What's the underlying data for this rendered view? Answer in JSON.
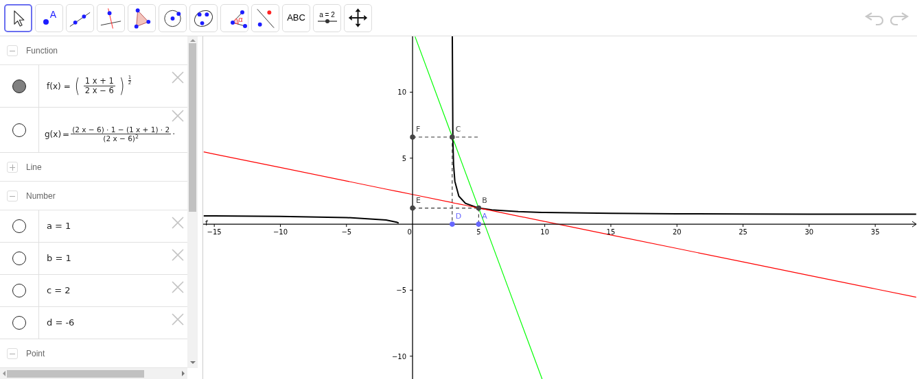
{
  "toolbar": {
    "tools": [
      {
        "kind": "move",
        "selected": true
      },
      {
        "kind": "point",
        "label": "A",
        "selected": false
      },
      {
        "kind": "line",
        "selected": false
      },
      {
        "kind": "perpendicular",
        "selected": false
      },
      {
        "kind": "polygon",
        "selected": false
      },
      {
        "kind": "circle",
        "selected": false
      },
      {
        "kind": "conic",
        "selected": false
      },
      {
        "kind": "angle",
        "label": "α",
        "selected": false
      },
      {
        "kind": "reflect",
        "selected": false
      },
      {
        "kind": "text",
        "label": "ABC",
        "selected": false
      },
      {
        "kind": "slider",
        "label": "a = 2",
        "selected": false
      },
      {
        "kind": "move_view",
        "selected": false
      }
    ],
    "undo_disabled": true,
    "redo_disabled": true
  },
  "algebra": {
    "groups": [
      {
        "title": "Function",
        "expanded": true,
        "items": [
          {
            "kind": "power",
            "visible": true,
            "name": "f(x)",
            "equals": "=",
            "left": "(",
            "numerator": "1 x + 1",
            "denominator": "2 x − 6",
            "right": ")",
            "exponent_numerator": "1",
            "exponent_denominator": "2"
          },
          {
            "kind": "fraction",
            "visible": false,
            "name": "g(x)",
            "equals": "=",
            "numerator": "(2 x − 6) · 1 − (1 x + 1) · 2",
            "denominator": "(2 x − 6)$^{2}$",
            "trailing": "·"
          }
        ]
      },
      {
        "title": "Line",
        "expanded": false
      },
      {
        "title": "Number",
        "expanded": true,
        "items": [
          {
            "kind": "text",
            "visible": false,
            "text": "a = 1"
          },
          {
            "kind": "text",
            "visible": false,
            "text": "b = 1"
          },
          {
            "kind": "text",
            "visible": false,
            "text": "c = 2"
          },
          {
            "kind": "text",
            "visible": false,
            "text": "d = -6"
          }
        ]
      },
      {
        "title": "Point",
        "expanded": true
      }
    ]
  },
  "graphics": {
    "chart_data": {
      "type": "line",
      "x": [
        -15.8,
        -15,
        -10,
        -5,
        -2,
        -1.2,
        -1.05,
        0.19,
        3.0099,
        3.05,
        3.1,
        3.2,
        3.5,
        4,
        5,
        6,
        8,
        9.8,
        10,
        15,
        20,
        25,
        30,
        35,
        38.1
      ],
      "series": [
        {
          "name": "f",
          "color": "#000000",
          "values": [
            0.63,
            0.62,
            0.59,
            0.5,
            0.32,
            0.15,
            0.08,
            null,
            14.23,
            6.36,
            4.53,
            3.24,
            2.12,
            1.58,
            1.22,
            1.08,
            0.95,
            0.89,
            0.89,
            0.82,
            0.79,
            0.77,
            0.76,
            0.75,
            0.75
          ]
        },
        {
          "color": "#ff0000",
          "values": [
            5.47,
            5.31,
            4.29,
            3.27,
            2.65,
            2.49,
            2.46,
            2.21,
            1.63,
            1.62,
            1.61,
            1.59,
            1.53,
            1.43,
            1.22,
            1.02,
            0.61,
            0.25,
            0.2,
            -0.82,
            -1.84,
            -2.86,
            -3.88,
            -4.9,
            -5.53
          ]
        },
        {
          "color": "#00ff00",
          "values": [
            null,
            null,
            null,
            null,
            null,
            null,
            null,
            14.21,
            6.6,
            6.49,
            6.35,
            6.09,
            5.27,
            3.92,
            1.22,
            -1.48,
            -6.88,
            -11.73,
            null,
            null,
            null,
            null,
            null,
            null,
            null
          ]
        }
      ],
      "xlim": [
        -15.84,
        38.16
      ],
      "ylim": [
        -11.73,
        14.23
      ],
      "xticks": [
        {
          "value": -15,
          "label": "−15"
        },
        {
          "value": -10,
          "label": "−10"
        },
        {
          "value": -5,
          "label": "−5"
        },
        0,
        5,
        10,
        15,
        20,
        25,
        30,
        35
      ],
      "yticks": [
        {
          "value": -10,
          "label": "−10"
        },
        {
          "value": -5,
          "label": "−5"
        },
        5,
        10
      ],
      "annotations": [
        {
          "text": "F",
          "x": 0,
          "y": 6.6
        },
        {
          "text": "C",
          "x": 3,
          "y": 6.6
        },
        {
          "text": "E",
          "x": 0,
          "y": 1.22
        },
        {
          "text": "B",
          "x": 5,
          "y": 1.22
        },
        {
          "text": "D",
          "x": 3,
          "y": 0
        },
        {
          "text": "A",
          "x": 5,
          "y": 0
        }
      ]
    }
  }
}
